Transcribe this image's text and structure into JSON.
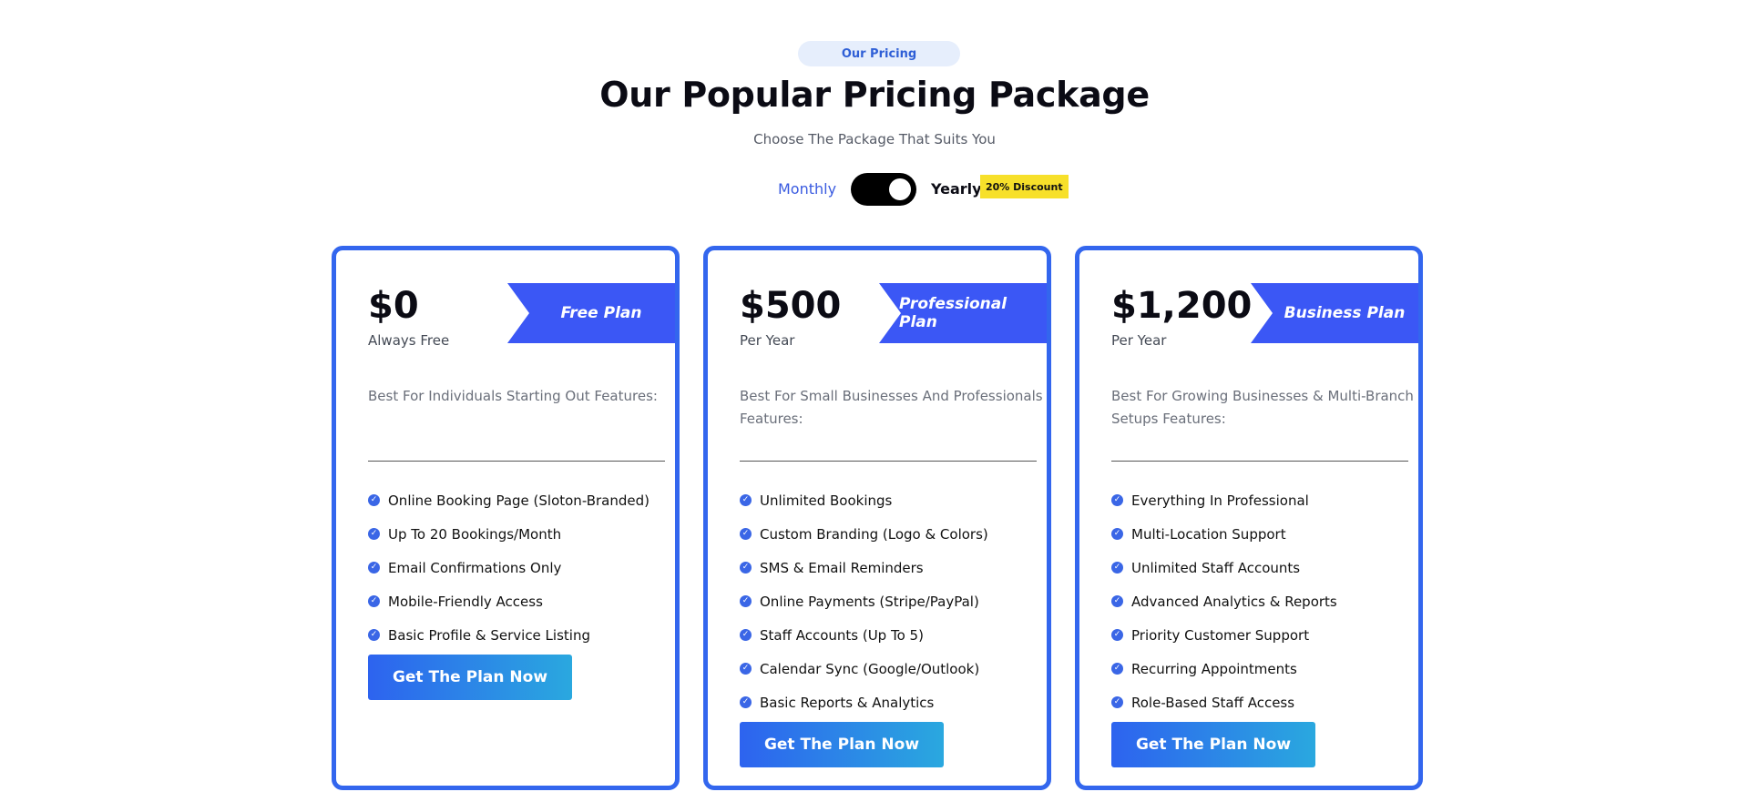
{
  "section": {
    "eyebrow": "Our Pricing",
    "title": "Our Popular Pricing Package",
    "subtitle": "Choose The Package That Suits You"
  },
  "billing_toggle": {
    "monthly_label": "Monthly",
    "yearly_label": "Yearly",
    "discount_badge": "20% Discount",
    "selected": "Yearly"
  },
  "colors": {
    "accent": "#3b57f5",
    "card_border_top": "#2f62ef",
    "card_border_bottom": "#2aa3e0",
    "badge": "#f7e02a"
  },
  "plans": [
    {
      "price": "$0",
      "period": "Always Free",
      "ribbon": "Free Plan",
      "description": "Best For Individuals Starting Out Features:",
      "features": [
        "Online Booking Page (Sloton-Branded)",
        "Up To 20 Bookings/Month",
        "Email Confirmations Only",
        "Mobile-Friendly Access",
        "Basic Profile & Service Listing"
      ],
      "cta": "Get The Plan Now"
    },
    {
      "price": "$500",
      "period": "Per Year",
      "ribbon": "Professional Plan",
      "description": "Best For Small Businesses And Professionals Features:",
      "features": [
        "Unlimited Bookings",
        "Custom Branding (Logo & Colors)",
        "SMS & Email Reminders",
        "Online Payments (Stripe/PayPal)",
        "Staff Accounts (Up To 5)",
        "Calendar Sync (Google/Outlook)",
        "Basic Reports & Analytics"
      ],
      "cta": "Get The Plan Now"
    },
    {
      "price": "$1,200",
      "period": "Per Year",
      "ribbon": "Business Plan",
      "description": "Best For Growing Businesses & Multi-Branch Setups Features:",
      "features": [
        "Everything In Professional",
        "Multi-Location Support",
        "Unlimited Staff Accounts",
        "Advanced Analytics & Reports",
        "Priority Customer Support",
        "Recurring Appointments",
        "Role-Based Staff Access"
      ],
      "cta": "Get The Plan Now"
    }
  ],
  "icons": {
    "feature_bullet": "check-circle-icon"
  }
}
